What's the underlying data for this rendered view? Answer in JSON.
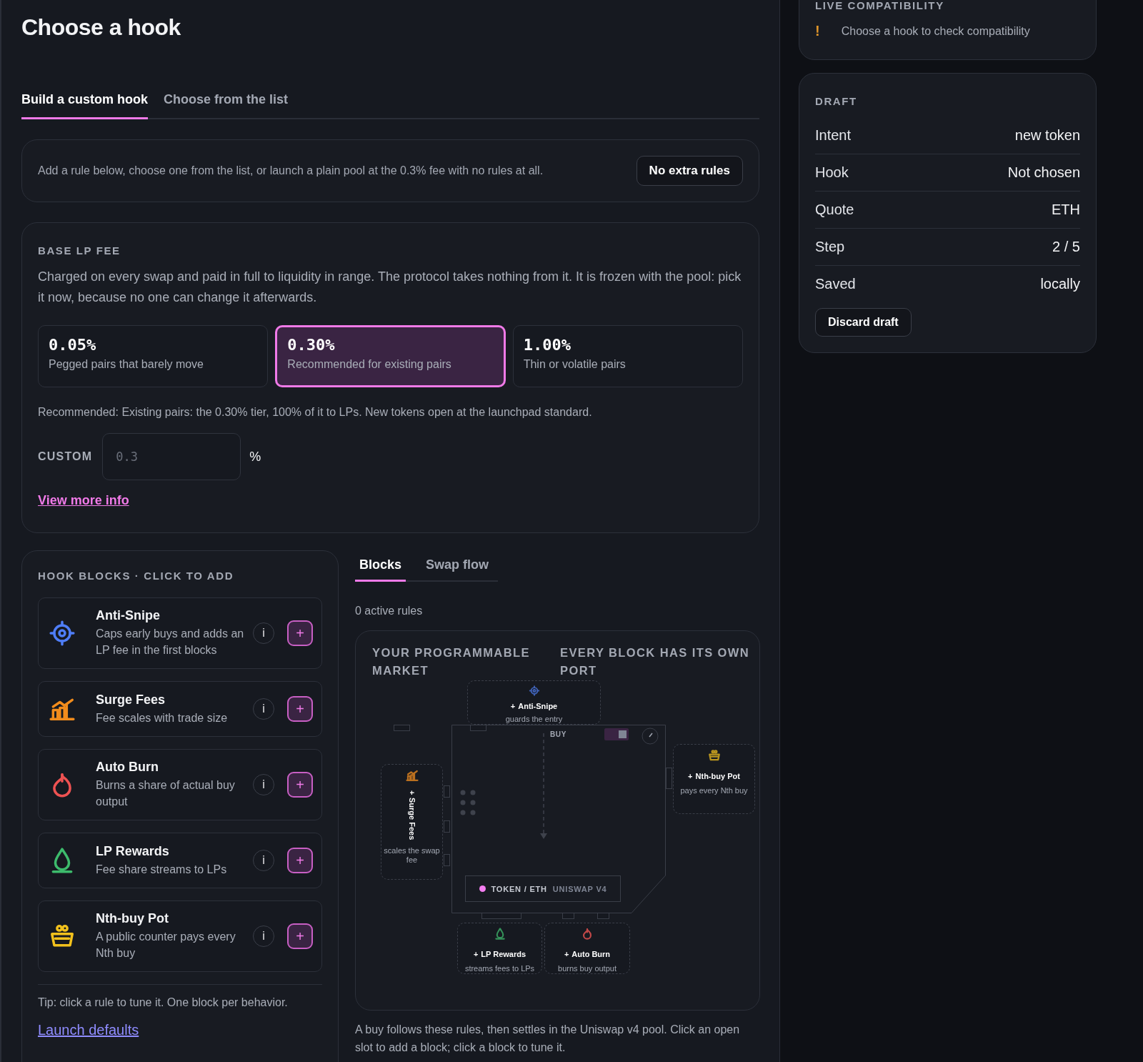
{
  "header": {
    "title": "Choose a hook"
  },
  "tabs": [
    {
      "label": "Build a custom hook",
      "selected": true
    },
    {
      "label": "Choose from the list",
      "selected": false
    }
  ],
  "notice": {
    "text": "Add a rule below, choose one from the list, or launch a plain pool at the 0.3% fee with no rules at all.",
    "button": "No extra rules"
  },
  "base_fee": {
    "heading": "BASE LP FEE",
    "description": "Charged on every swap and paid in full to liquidity in range. The protocol takes nothing from it. It is frozen with the pool: pick it now, because no one can change it afterwards.",
    "tiers": [
      {
        "value": "0.05%",
        "caption": "Pegged pairs that barely move",
        "selected": false
      },
      {
        "value": "0.30%",
        "caption": "Recommended for existing pairs",
        "selected": true
      },
      {
        "value": "1.00%",
        "caption": "Thin or volatile pairs",
        "selected": false
      }
    ],
    "recommendation": "Recommended: Existing pairs: the 0.30% tier, 100% of it to LPs. New tokens open at the launchpad standard.",
    "custom": {
      "label": "CUSTOM",
      "placeholder": "0.3",
      "unit": "%"
    },
    "link": "View more info"
  },
  "hook_blocks": {
    "heading": "HOOK BLOCKS · CLICK TO ADD",
    "items": [
      {
        "kind": "target",
        "color": "#4f7ef7",
        "title": "Anti-Snipe",
        "description": "Caps early buys and adds an LP fee in the first blocks",
        "info": "i",
        "add": "+"
      },
      {
        "kind": "chart",
        "color": "#f28c1c",
        "title": "Surge Fees",
        "description": "Fee scales with trade size",
        "info": "i",
        "add": "+"
      },
      {
        "kind": "flame",
        "color": "#ee5252",
        "title": "Auto Burn",
        "description": "Burns a share of actual buy output",
        "info": "i",
        "add": "+"
      },
      {
        "kind": "drop",
        "color": "#3dbb6c",
        "title": "LP Rewards",
        "description": "Fee share streams to LPs",
        "info": "i",
        "add": "+"
      },
      {
        "kind": "basket",
        "color": "#f2c11c",
        "title": "Nth-buy Pot",
        "description": "A public counter pays every Nth buy",
        "info": "i",
        "add": "+"
      }
    ],
    "tip": "Tip: click a rule to tune it. One block per behavior.",
    "link": "Launch defaults"
  },
  "view_tabs": [
    {
      "label": "Blocks",
      "selected": true
    },
    {
      "label": "Swap flow",
      "selected": false
    }
  ],
  "active_rules": "0 active rules",
  "diagram": {
    "headings": [
      "YOUR PROGRAMMABLE MARKET",
      "EVERY BLOCK HAS ITS OWN PORT"
    ],
    "slots": [
      {
        "kind": "target",
        "color": "#4063b8",
        "plus": "+",
        "title": "Anti-Snipe",
        "subtitle": "guards the entry"
      },
      {
        "kind": "chart",
        "color": "#b96f1f",
        "plus": "+",
        "title": "Surge Fees",
        "subtitle": "scales the swap fee"
      },
      {
        "kind": "basket",
        "color": "#b9951f",
        "plus": "+",
        "title": "Nth-buy Pot",
        "subtitle": "pays every Nth buy"
      },
      {
        "kind": "drop",
        "color": "#35925a",
        "plus": "+",
        "title": "LP Rewards",
        "subtitle": "streams fees to LPs"
      },
      {
        "kind": "flame",
        "color": "#c24848",
        "plus": "+",
        "title": "Auto Burn",
        "subtitle": "burns buy output"
      }
    ],
    "flow_label": "BUY",
    "toggle": {
      "on": true
    },
    "pool": {
      "pair": "TOKEN / ETH",
      "protocol": "UNISWAP V4",
      "color": "#f47ef0"
    }
  },
  "caption": "A buy follows these rules, then settles in the Uniswap v4 pool. Click an open slot to add a block; click a block to tune it.",
  "compatibility": {
    "heading": "LIVE COMPATIBILITY",
    "message": "Choose a hook to check compatibility",
    "mark": "!"
  },
  "draft": {
    "heading": "DRAFT",
    "rows": [
      {
        "label": "Intent",
        "value": "new token"
      },
      {
        "label": "Hook",
        "value": "Not chosen"
      },
      {
        "label": "Quote",
        "value": "ETH"
      },
      {
        "label": "Step",
        "value": "2 / 5"
      },
      {
        "label": "Saved",
        "value": "locally"
      }
    ],
    "button": "Discard draft"
  }
}
